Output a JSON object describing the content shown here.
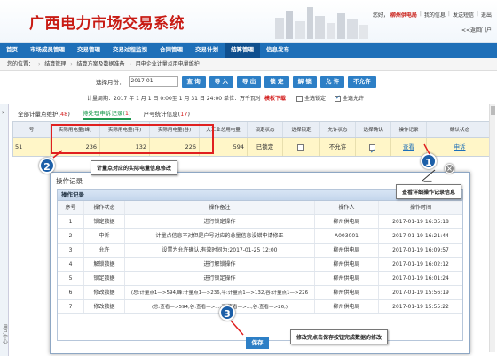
{
  "app": {
    "title": "广西电力市场交易系统",
    "user_greeting": "您好，",
    "user_name": "柳州供电局",
    "links": [
      "我的信息",
      "发送短信",
      "退出"
    ],
    "return_portal": "<<返回门户"
  },
  "nav": {
    "items": [
      "首页",
      "市场成员管理",
      "交易管理",
      "交易过程监视",
      "合同管理",
      "交易计划",
      "结算管理",
      "信息发布"
    ],
    "active_index": 6
  },
  "breadcrumb": {
    "label": "您的位置：",
    "items": [
      "结算管理",
      "结算方案及数据准备",
      "用电企业计量点用电量维护"
    ]
  },
  "toolbar": {
    "month_label": "选择月份：",
    "month_value": "2017-01",
    "buttons": [
      "查 询",
      "导 入",
      "导 出",
      "锁 定",
      "解 锁",
      "允 许",
      "不允许"
    ]
  },
  "period": {
    "text": "计量周期：2017 年 1 月 1 日 0:00至 1 月 31 日 24:00 单位：万千瓦时",
    "template_link": "模板下载",
    "check_all_lock": "全选锁定",
    "check_all_allow": "全选允许"
  },
  "tabs": [
    {
      "label": "全部计量点维护",
      "count": "48"
    },
    {
      "label": "待处理申诉记录",
      "count": "1"
    },
    {
      "label": "户号统计信息",
      "count": "17"
    }
  ],
  "active_tab": 1,
  "grid": {
    "headers": [
      "号",
      "实际用电量(峰)",
      "实际用电量(平)",
      "实际用电量(谷)",
      "大工业总用电量",
      "锁定状态",
      "选择锁定",
      "允许状态",
      "选择确认",
      "操作记录",
      "确认状态"
    ],
    "row": {
      "id": "51",
      "peak": "236",
      "flat": "132",
      "valley": "226",
      "total": "594",
      "lock_status": "已锁定",
      "allow_status": "不允许",
      "record_link": "查看",
      "confirm": "申诉"
    }
  },
  "annotations": {
    "step1_number": "1",
    "step1_text": "查看详细操作记录信息",
    "step2_number": "2",
    "step2_text": "计量点对应的实际电量信息修改",
    "step3_number": "3",
    "step3_text": "修改完点击保存按钮完成数据的修改",
    "close_symbol": "×"
  },
  "dialog": {
    "title": "操作记录",
    "minimize": "—",
    "panel_title": "操作记录",
    "headers": [
      "序号",
      "操作状态",
      "操作备注",
      "操作人",
      "操作时间"
    ],
    "rows": [
      {
        "no": "1",
        "status": "锁定数据",
        "note": "进行锁定操作",
        "user": "柳州供电局",
        "time": "2017-01-19 16:35:18"
      },
      {
        "no": "2",
        "status": "申诉",
        "note": "计量点信息不对但是户号对应的总量信息没错申请修正",
        "user": "A003001",
        "time": "2017-01-19 16:21:44"
      },
      {
        "no": "3",
        "status": "允许",
        "note": "设置为允许确认,有效时间为:2017-01-25 12:00",
        "user": "柳州供电局",
        "time": "2017-01-19 16:09:57"
      },
      {
        "no": "4",
        "status": "解锁数据",
        "note": "进行解锁操作",
        "user": "柳州供电局",
        "time": "2017-01-19 16:02:12"
      },
      {
        "no": "5",
        "status": "锁定数据",
        "note": "进行锁定操作",
        "user": "柳州供电局",
        "time": "2017-01-19 16:01:24"
      },
      {
        "no": "6",
        "status": "修改数据",
        "note": "(总:计量点1—>594,峰:计量点1—>236,平:计量点1—>132,谷:计量点1—>226",
        "user": "柳州供电局",
        "time": "2017-01-19 15:56:19"
      },
      {
        "no": "7",
        "status": "修改数据",
        "note": "(总:查看—>594,谷:查看—>...,平:查看—>...,谷:查看—>26,)",
        "user": "柳州供电局",
        "time": "2017-01-19 15:55:22"
      }
    ],
    "save_label": "保存"
  },
  "left_strip": {
    "arrow": "›",
    "vertical_text": "用户中心"
  },
  "colors": {
    "brand_red": "#c81b14",
    "nav_blue": "#1e6fb8",
    "highlight_yellow": "#fff6c8",
    "callout_blue": "#1c5fa8"
  }
}
